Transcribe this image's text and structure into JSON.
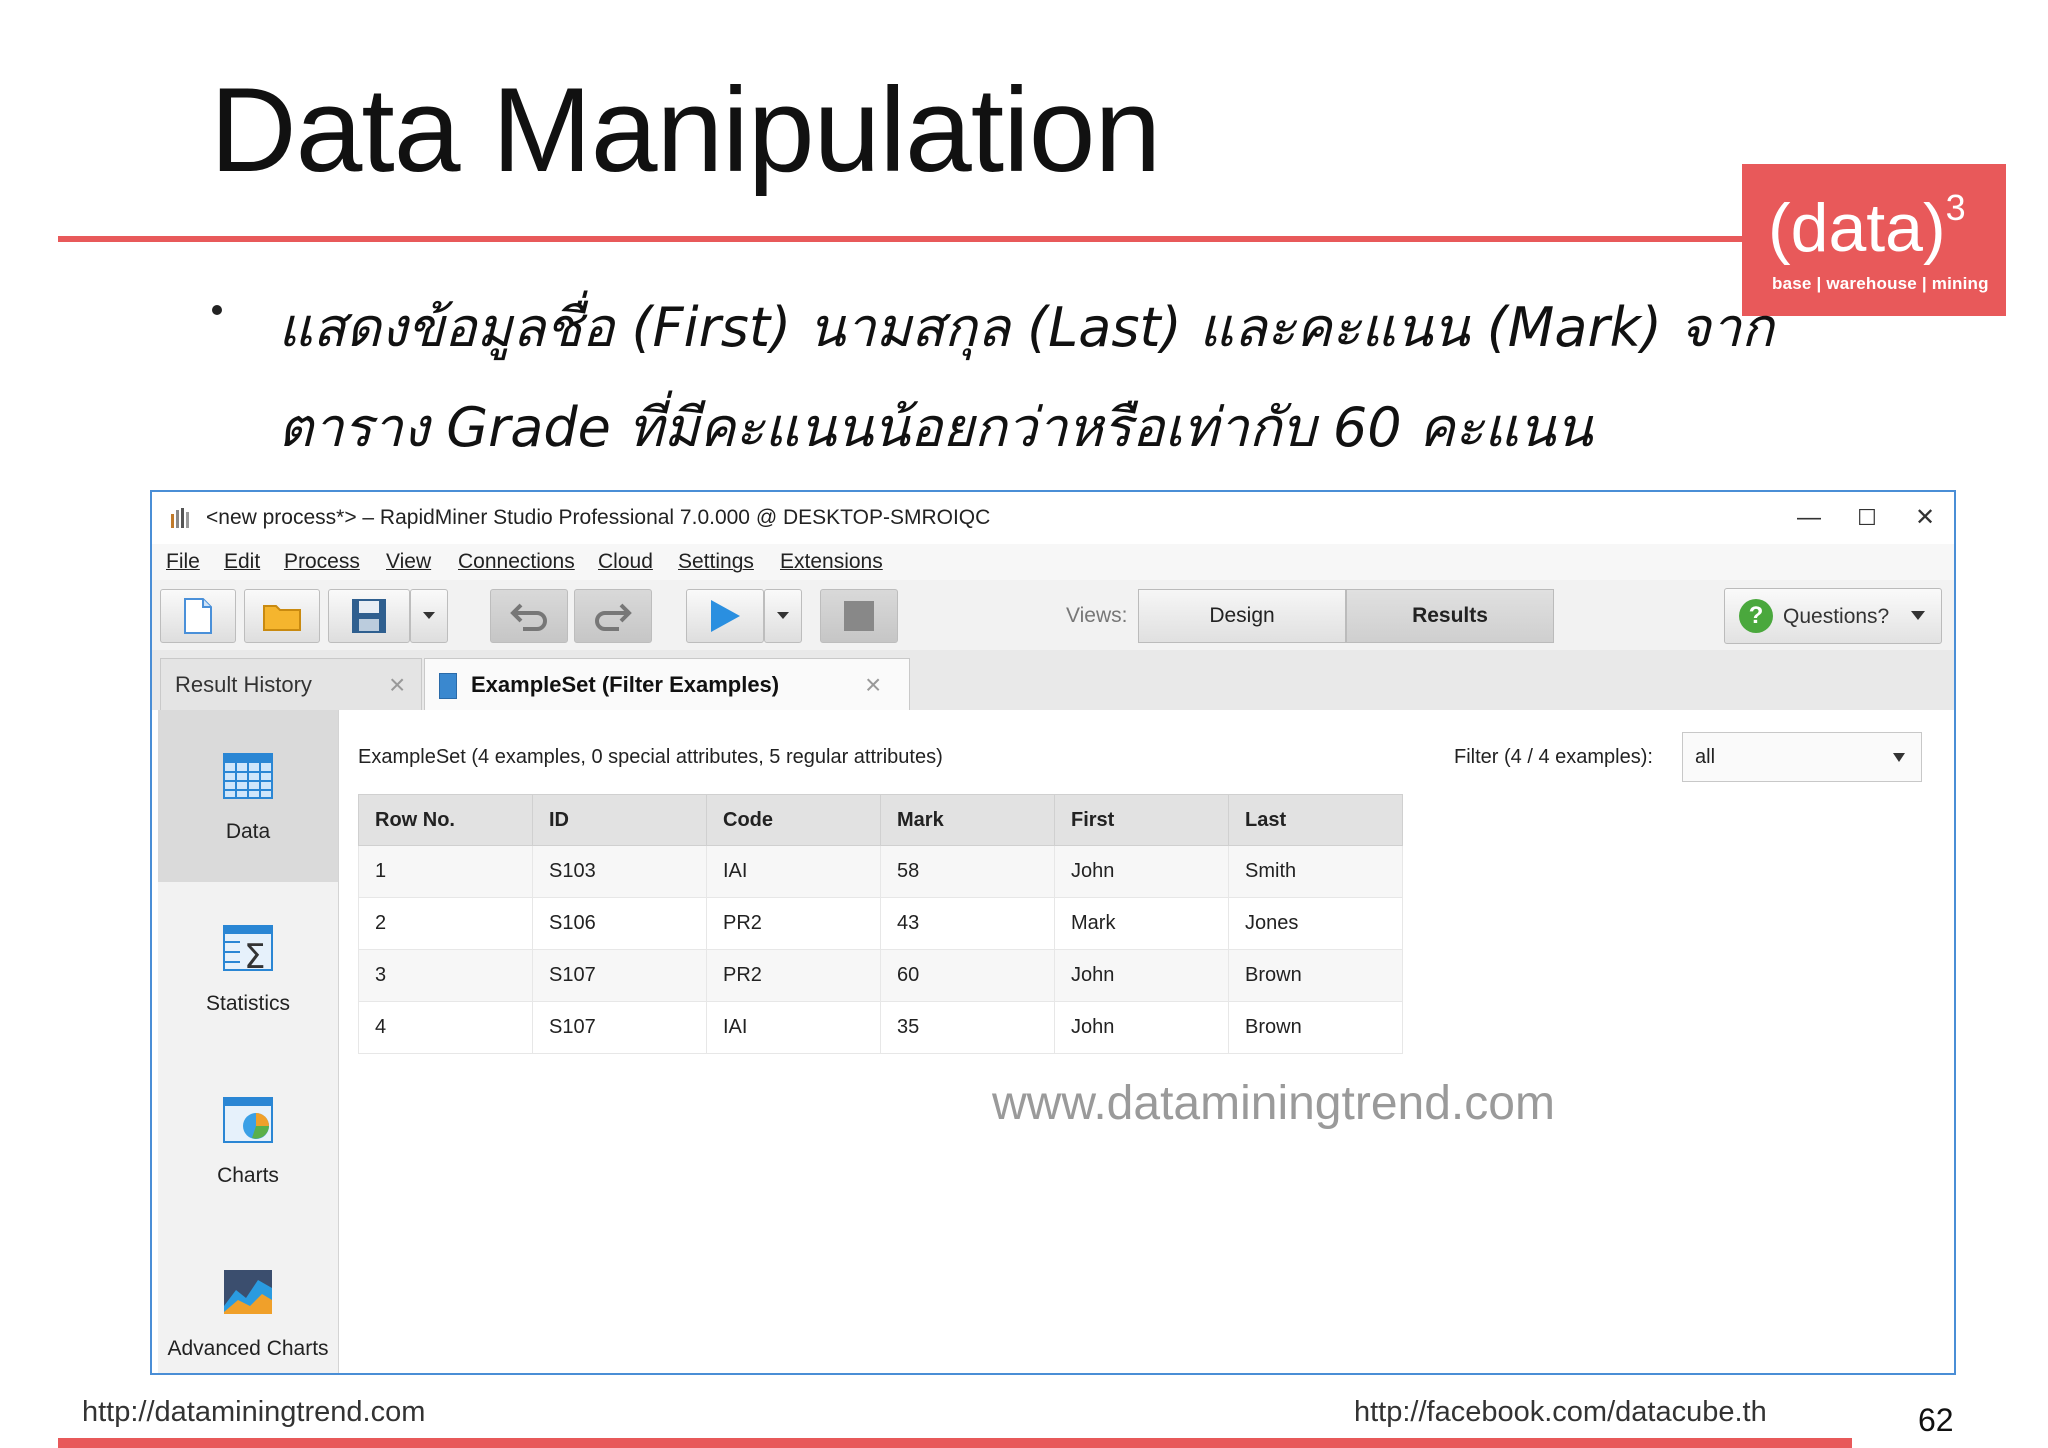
{
  "slide": {
    "title": "Data Manipulation",
    "bullet_line_1": "แสดงข้อมูลชื่อ (First) นามสกุล (Last) และคะแนน (Mark) จาก",
    "bullet_line_2": "ตาราง Grade ที่มีคะแนนน้อยกว่าหรือเท่ากับ 60 คะแนน",
    "page_number": "62",
    "footer_left": "http://dataminingtrend.com",
    "footer_right": "http://facebook.com/datacube.th",
    "accent_color": "#e8595a"
  },
  "logo": {
    "main": "(data)",
    "superscript": "3",
    "tagline": "base | warehouse | mining"
  },
  "window": {
    "title": "<new process*> – RapidMiner Studio Professional 7.0.000 @ DESKTOP-SMROIQC",
    "controls": {
      "minimize": "—",
      "maximize": "☐",
      "close": "✕"
    },
    "menu": [
      "File",
      "Edit",
      "Process",
      "View",
      "Connections",
      "Cloud",
      "Settings",
      "Extensions"
    ],
    "toolbar": {
      "views_label": "Views:",
      "view_design": "Design",
      "view_results": "Results",
      "questions": "Questions?"
    },
    "tabs": {
      "history": "Result History",
      "example": "ExampleSet (Filter Examples)"
    },
    "sidebar": [
      "Data",
      "Statistics",
      "Charts",
      "Advanced Charts"
    ],
    "summary": "ExampleSet (4 examples, 0 special attributes, 5 regular attributes)",
    "filter_label": "Filter (4 / 4 examples):",
    "filter_value": "all",
    "columns": [
      "Row No.",
      "ID",
      "Code",
      "Mark",
      "First",
      "Last"
    ],
    "rows": [
      [
        "1",
        "S103",
        "IAI",
        "58",
        "John",
        "Smith"
      ],
      [
        "2",
        "S106",
        "PR2",
        "43",
        "Mark",
        "Jones"
      ],
      [
        "3",
        "S107",
        "PR2",
        "60",
        "John",
        "Brown"
      ],
      [
        "4",
        "S107",
        "IAI",
        "35",
        "John",
        "Brown"
      ]
    ],
    "watermark": "www.dataminingtrend.com"
  }
}
